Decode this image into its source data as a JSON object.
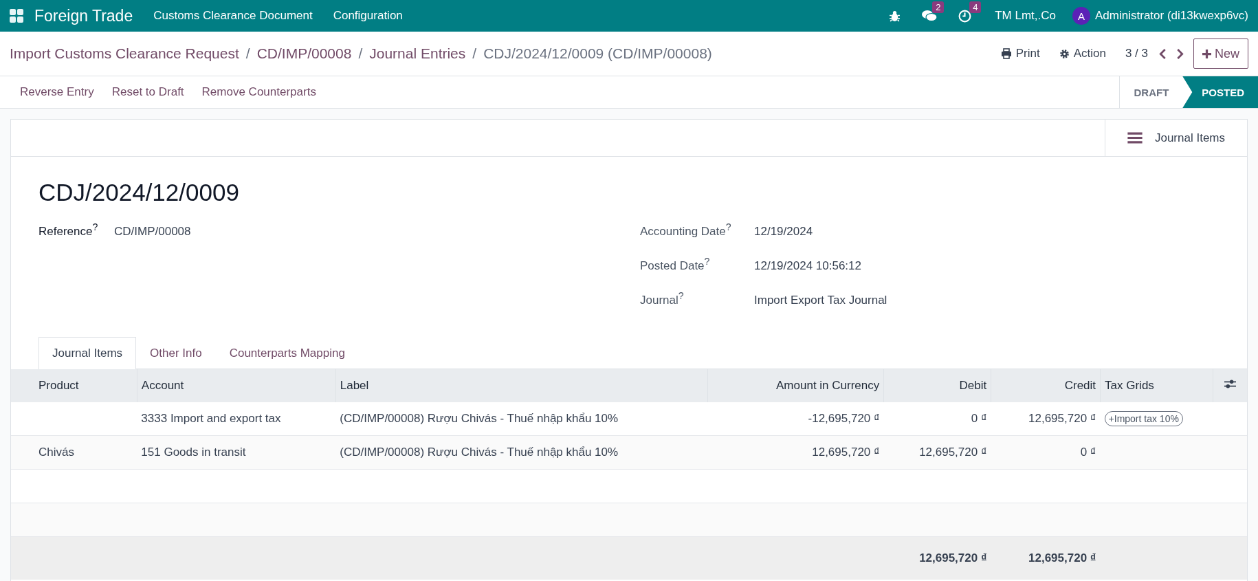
{
  "navbar": {
    "app_name": "Foreign Trade",
    "menus": [
      "Customs Clearance Document",
      "Configuration"
    ],
    "messages_count": "2",
    "activities_count": "4",
    "company": "TM Lmt,.Co",
    "user_initial": "A",
    "user": "Administrator (di13kwexp6vc)"
  },
  "breadcrumb_separator": "/",
  "breadcrumbs": [
    {
      "label": "Import Customs Clearance Request",
      "kind": "link"
    },
    {
      "label": "CD/IMP/00008",
      "kind": "link"
    },
    {
      "label": "Journal Entries",
      "kind": "link"
    },
    {
      "label": "CDJ/2024/12/0009 (CD/IMP/00008)",
      "kind": "current"
    }
  ],
  "control_panel": {
    "print": "Print",
    "action": "Action",
    "pager": "3 / 3",
    "new": "New"
  },
  "actions": [
    "Reverse Entry",
    "Reset to Draft",
    "Remove Counterparts"
  ],
  "stages": [
    {
      "label": "DRAFT",
      "selected": false
    },
    {
      "label": "POSTED",
      "selected": true
    }
  ],
  "smart_button": "Journal Items",
  "record": {
    "title": "CDJ/2024/12/0009",
    "left_fields": [
      {
        "label": "Reference",
        "help": "?",
        "value": "CD/IMP/00008"
      }
    ],
    "right_fields": [
      {
        "label": "Accounting Date",
        "help": "?",
        "value": "12/19/2024"
      },
      {
        "label": "Posted Date",
        "help": "?",
        "value": "12/19/2024 10:56:12"
      },
      {
        "label": "Journal",
        "help": "?",
        "value": "Import Export Tax Journal"
      }
    ]
  },
  "tabs": [
    {
      "label": "Journal Items",
      "selected": true
    },
    {
      "label": "Other Info",
      "selected": false
    },
    {
      "label": "Counterparts Mapping",
      "selected": false
    }
  ],
  "table": {
    "columns": [
      "Product",
      "Account",
      "Label",
      "Amount in Currency",
      "Debit",
      "Credit",
      "Tax Grids"
    ],
    "rows": [
      {
        "cells": [
          "",
          "3333 Import and export tax",
          "(CD/IMP/00008) Rượu Chivás - Thuế nhập khẩu 10%",
          "-12,695,720 ₫",
          "0 ₫",
          "12,695,720 ₫"
        ],
        "tags": [
          "+Import tax 10%"
        ]
      },
      {
        "cells": [
          "Chivás",
          "151 Goods in transit",
          "(CD/IMP/00008) Rượu Chivás - Thuế nhập khẩu 10%",
          "12,695,720 ₫",
          "12,695,720 ₫",
          "0 ₫"
        ],
        "tags": []
      }
    ],
    "totals": {
      "debit": "12,695,720 ₫",
      "credit": "12,695,720 ₫"
    }
  }
}
